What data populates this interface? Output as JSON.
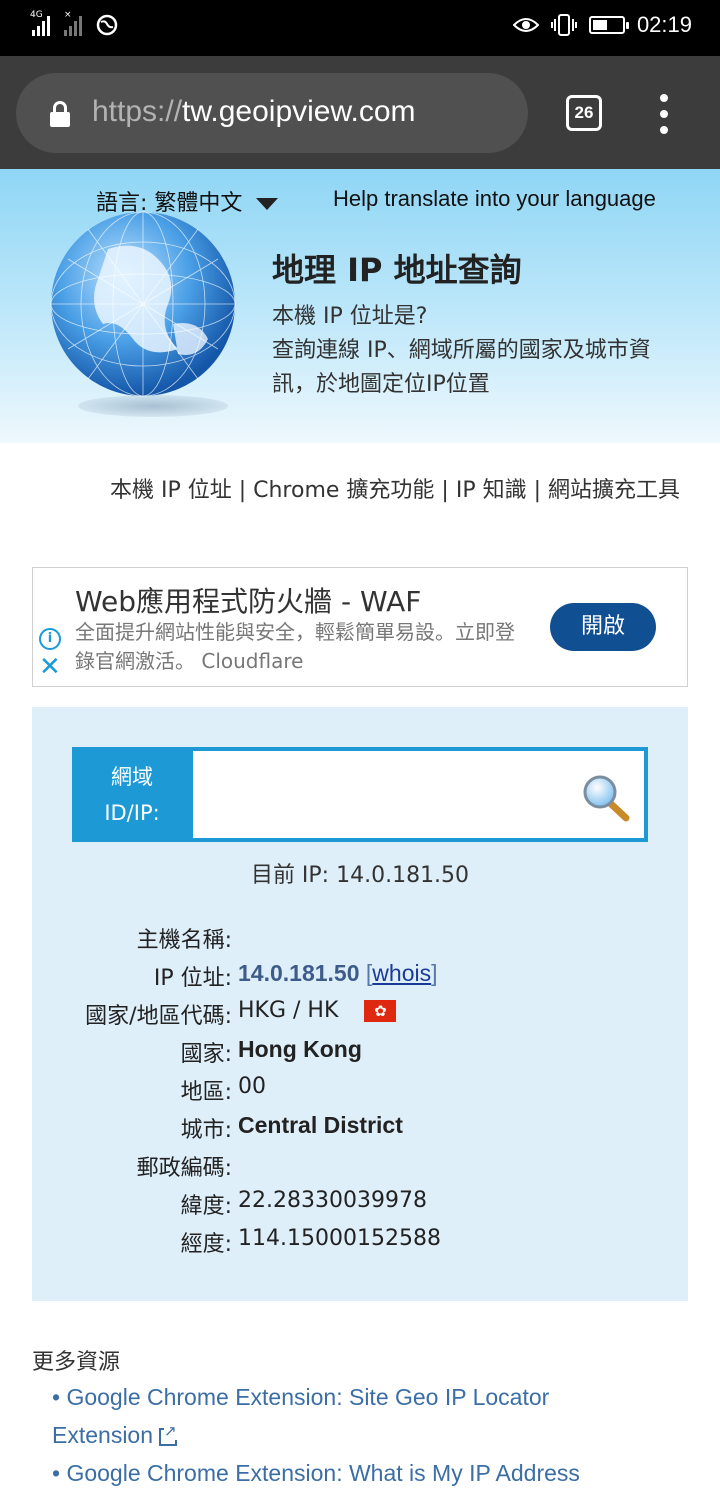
{
  "status_bar": {
    "signal1_label": "4G",
    "time": "02:19"
  },
  "browser": {
    "url_scheme": "https://",
    "url_host": "tw.geoipview.com",
    "tab_count": "26"
  },
  "header": {
    "language_label": "語言: 繁體中文",
    "help_translate": "Help translate into your language",
    "title": "地理 IP 地址查詢",
    "subtitle": "本機 IP 位址是?\n查詢連線 IP、網域所屬的國家及城市資訊，於地圖定位IP位置"
  },
  "nav": {
    "items": [
      "本機 IP 位址",
      "Chrome 擴充功能",
      "IP 知識",
      "網站擴充工具"
    ],
    "separator": " | "
  },
  "ad": {
    "title": "Web應用程式防火牆 - WAF",
    "description": "全面提升網站性能與安全，輕鬆簡單易設。立即登錄官網激活。 Cloudflare",
    "button_label": "開啟",
    "info_icon": "info-icon",
    "close_icon": "close-icon"
  },
  "lookup": {
    "search_label": "網域 ID/IP:",
    "search_value": "",
    "current_ip": "目前 IP: 14.0.181.50",
    "rows": [
      {
        "key": "主機名稱:",
        "value": ""
      },
      {
        "key": "IP 位址:",
        "value": "14.0.181.50"
      },
      {
        "key": "國家/地區代碼:",
        "value": "HKG / HK"
      },
      {
        "key": "國家:",
        "value": "Hong Kong"
      },
      {
        "key": "地區:",
        "value": "00"
      },
      {
        "key": "城市:",
        "value": "Central District"
      },
      {
        "key": "郵政編碼:",
        "value": ""
      },
      {
        "key": "緯度:",
        "value": "22.28330039978"
      },
      {
        "key": "經度:",
        "value": "114.15000152588"
      }
    ],
    "whois_label": "whois",
    "bracket_open": "[",
    "bracket_close": "]"
  },
  "more_resources": {
    "title": "更多資源",
    "items": [
      "• Google Chrome Extension: Site Geo IP Locator",
      "Extension",
      "• Google Chrome Extension: What is My IP Address"
    ]
  },
  "colors": {
    "panel_bg": "#dfeffa",
    "search_blue": "#1d9ad6",
    "ad_button": "#0f4f92",
    "link_blue": "#3b6ea5"
  }
}
